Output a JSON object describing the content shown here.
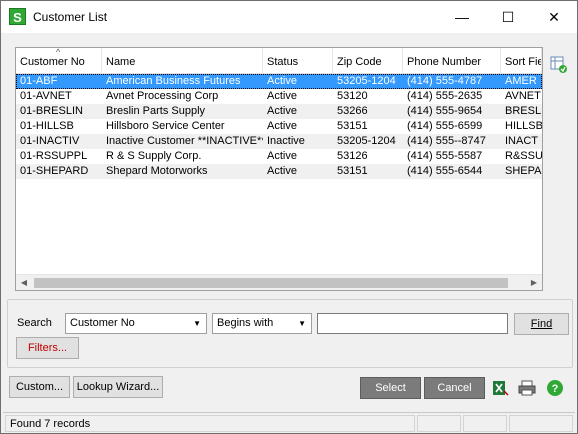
{
  "window": {
    "title": "Customer List",
    "app_icon_letter": "S",
    "minimize": "—",
    "maximize": "☐",
    "close": "✕"
  },
  "grid": {
    "columns": [
      "Customer No",
      "Name",
      "Status",
      "Zip Code",
      "Phone Number",
      "Sort Fie"
    ],
    "sort_indicator": "^",
    "rows": [
      {
        "customer_no": "01-ABF",
        "name": "American Business Futures",
        "status": "Active",
        "zip": "53205-1204",
        "phone": "(414) 555-4787",
        "sort": "AMER"
      },
      {
        "customer_no": "01-AVNET",
        "name": "Avnet Processing Corp",
        "status": "Active",
        "zip": "53120",
        "phone": "(414) 555-2635",
        "sort": "AVNET"
      },
      {
        "customer_no": "01-BRESLIN",
        "name": "Breslin Parts Supply",
        "status": "Active",
        "zip": "53266",
        "phone": "(414) 555-9654",
        "sort": "BRESLIN"
      },
      {
        "customer_no": "01-HILLSB",
        "name": "Hillsboro Service Center",
        "status": "Active",
        "zip": "53151",
        "phone": "(414) 555-6599",
        "sort": "HILLSB"
      },
      {
        "customer_no": "01-INACTIV",
        "name": "Inactive Customer **INACTIVE**",
        "status": "Inactive",
        "zip": "53205-1204",
        "phone": "(414) 555--8747",
        "sort": "INACT"
      },
      {
        "customer_no": "01-RSSUPPL",
        "name": "R & S Supply Corp.",
        "status": "Active",
        "zip": "53126",
        "phone": "(414) 555-5587",
        "sort": "R&SSUI"
      },
      {
        "customer_no": "01-SHEPARD",
        "name": "Shepard Motorworks",
        "status": "Active",
        "zip": "53151",
        "phone": "(414) 555-6544",
        "sort": "SHEPAR"
      }
    ],
    "selected_row": 0
  },
  "search": {
    "label": "Search",
    "field_value": "Customer No",
    "operator_value": "Begins with",
    "text_value": "",
    "find_label": "Find",
    "filters_label": "Filters..."
  },
  "footer": {
    "custom_label": "Custom...",
    "lookup_wizard_label": "Lookup Wizard...",
    "select_label": "Select",
    "cancel_label": "Cancel"
  },
  "status": {
    "records_text": "Found 7 records"
  },
  "colors": {
    "selection": "#3399ff",
    "app_icon": "#2fa836",
    "filters_text": "#c00000"
  }
}
